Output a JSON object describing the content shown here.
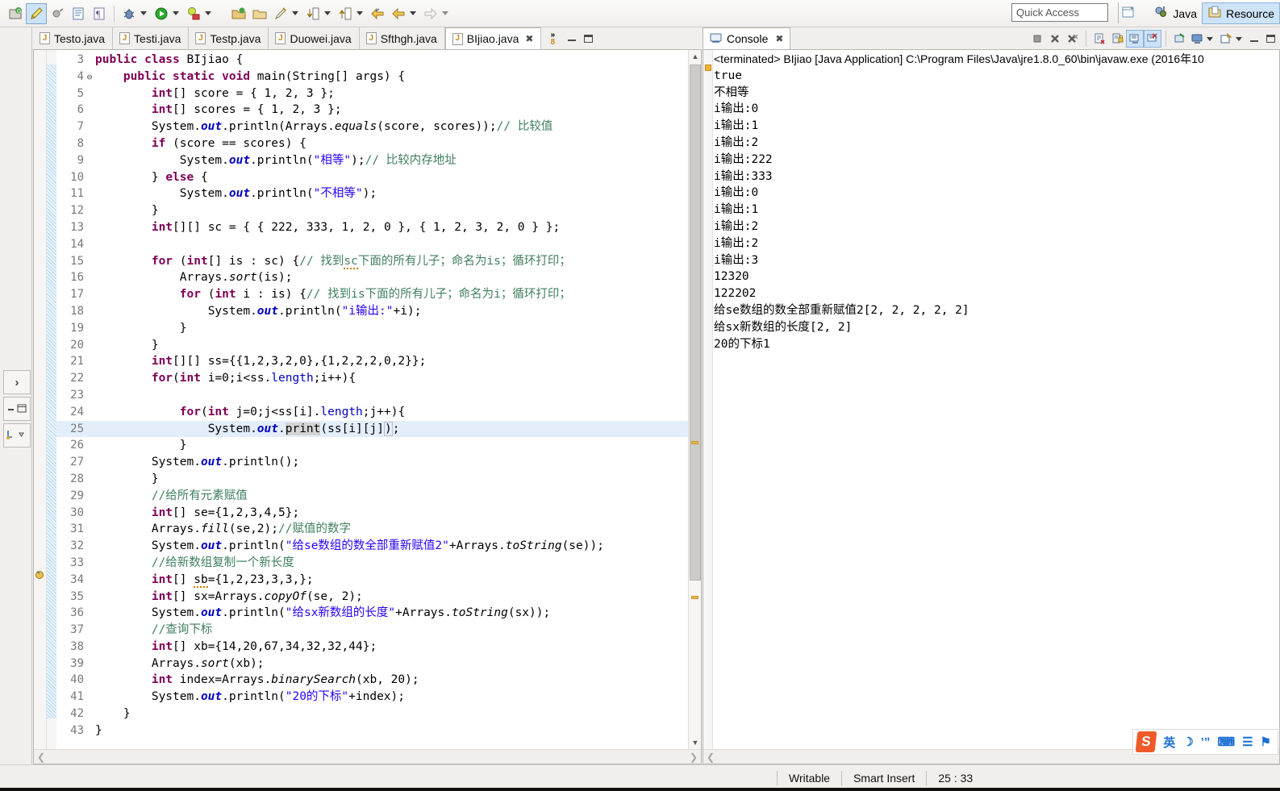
{
  "toolbar": {
    "icons": [
      {
        "name": "new-java-project-icon",
        "glyph": "⚙"
      },
      {
        "name": "highlighter-icon",
        "glyph": "✒"
      },
      {
        "name": "toggle-mark-occurrences-icon",
        "glyph": "●"
      },
      {
        "name": "open-type-icon",
        "glyph": "▤"
      },
      {
        "name": "show-whitespace-icon",
        "glyph": "¶"
      },
      {
        "name": "debug-icon",
        "glyph": "✹"
      },
      {
        "name": "run-icon",
        "glyph": "▶"
      },
      {
        "name": "run-external-tools-icon",
        "glyph": "●"
      },
      {
        "name": "new-java-package-icon",
        "glyph": "■"
      },
      {
        "name": "open-package-icon",
        "glyph": "□"
      },
      {
        "name": "new-class-icon",
        "glyph": "✎"
      },
      {
        "name": "previous-annotation-icon",
        "glyph": "↓"
      },
      {
        "name": "next-annotation-icon",
        "glyph": "↑"
      },
      {
        "name": "back-icon",
        "glyph": "⇐"
      },
      {
        "name": "backward-history-icon",
        "glyph": "⇐"
      },
      {
        "name": "forward-history-icon",
        "glyph": "⇒"
      }
    ],
    "quick_access_placeholder": "Quick Access",
    "perspective_open_label": "",
    "perspective_java_label": "Java",
    "perspective_resource_label": "Resource"
  },
  "editor": {
    "tabs": [
      {
        "label": "Testo.java",
        "active": false,
        "closable": false
      },
      {
        "label": "Testi.java",
        "active": false,
        "closable": false
      },
      {
        "label": "Testp.java",
        "active": false,
        "closable": false
      },
      {
        "label": "Duowei.java",
        "active": false,
        "closable": false
      },
      {
        "label": "Sfthgh.java",
        "active": false,
        "closable": false
      },
      {
        "label": "BIjiao.java",
        "active": true,
        "closable": true
      }
    ],
    "overflow_count": "8",
    "first_line_number": 3,
    "highlighted_line": 25,
    "lines": [
      {
        "n": "3",
        "fold": "",
        "html": "<span class=\"kw\">public class</span> <span class=\"plain\">BIjiao {</span>"
      },
      {
        "n": "4",
        "fold": "⊖",
        "html": "    <span class=\"kw\">public static void</span> <span class=\"plain\">main(String[] args) {</span>"
      },
      {
        "n": "5",
        "fold": "",
        "html": "        <span class=\"kw\">int</span><span class=\"plain\">[] score = { 1, 2, 3 };</span>"
      },
      {
        "n": "6",
        "fold": "",
        "html": "        <span class=\"kw\">int</span><span class=\"plain\">[] scores = { 1, 2, 3 };</span>"
      },
      {
        "n": "7",
        "fold": "",
        "html": "        <span class=\"plain\">System.</span><span class=\"stb\">out</span><span class=\"plain\">.println(Arrays.</span><span class=\"stat\">equals</span><span class=\"plain\">(score, scores));</span><span class=\"cmt\">// 比较值</span>"
      },
      {
        "n": "8",
        "fold": "",
        "html": "        <span class=\"kw\">if</span> <span class=\"plain\">(score == scores) {</span>"
      },
      {
        "n": "9",
        "fold": "",
        "html": "            <span class=\"plain\">System.</span><span class=\"stb\">out</span><span class=\"plain\">.println(</span><span class=\"str\">\"相等\"</span><span class=\"plain\">);</span><span class=\"cmt\">// 比较内存地址</span>"
      },
      {
        "n": "10",
        "fold": "",
        "html": "        <span class=\"plain\">} </span><span class=\"kw\">else</span> <span class=\"plain\">{</span>"
      },
      {
        "n": "11",
        "fold": "",
        "html": "            <span class=\"plain\">System.</span><span class=\"stb\">out</span><span class=\"plain\">.println(</span><span class=\"str\">\"不相等\"</span><span class=\"plain\">);</span>"
      },
      {
        "n": "12",
        "fold": "",
        "html": "        <span class=\"plain\">}</span>"
      },
      {
        "n": "13",
        "fold": "",
        "html": "        <span class=\"kw\">int</span><span class=\"plain\">[][] sc = { { 222, 333, 1, 2, 0 }, { 1, 2, 3, 2, 0 } };</span>"
      },
      {
        "n": "14",
        "fold": "",
        "html": ""
      },
      {
        "n": "15",
        "fold": "",
        "html": "        <span class=\"kw\">for</span> <span class=\"plain\">(</span><span class=\"kw\">int</span><span class=\"plain\">[] is : sc) {</span><span class=\"cmt\">// 找到</span><span class=\"cmt squiggle\">sc</span><span class=\"cmt\">下面的所有儿子；命名为is；循环打印；</span>"
      },
      {
        "n": "16",
        "fold": "",
        "html": "            <span class=\"plain\">Arrays.</span><span class=\"stat\">sort</span><span class=\"plain\">(is);</span>"
      },
      {
        "n": "17",
        "fold": "",
        "html": "            <span class=\"kw\">for</span> <span class=\"plain\">(</span><span class=\"kw\">int</span><span class=\"plain\"> i : is) {</span><span class=\"cmt\">// 找到is下面的所有儿子；命名为i；循环打印；</span>"
      },
      {
        "n": "18",
        "fold": "",
        "html": "                <span class=\"plain\">System.</span><span class=\"stb\">out</span><span class=\"plain\">.println(</span><span class=\"str\">\"i输出:\"</span><span class=\"plain\">+i);</span>"
      },
      {
        "n": "19",
        "fold": "",
        "html": "            <span class=\"plain\">}</span>"
      },
      {
        "n": "20",
        "fold": "",
        "html": "        <span class=\"plain\">}</span>"
      },
      {
        "n": "21",
        "fold": "",
        "html": "        <span class=\"kw\">int</span><span class=\"plain\">[][] ss={{1,2,3,2,0},{1,2,2,2,0,2}};</span>"
      },
      {
        "n": "22",
        "fold": "",
        "html": "        <span class=\"kw\">for</span><span class=\"plain\">(</span><span class=\"kw\">int</span><span class=\"plain\"> i=0;i&lt;ss.</span><span class=\"fld\">length</span><span class=\"plain\">;i++){</span>"
      },
      {
        "n": "23",
        "fold": "",
        "html": ""
      },
      {
        "n": "24",
        "fold": "",
        "html": "            <span class=\"kw\">for</span><span class=\"plain\">(</span><span class=\"kw\">int</span><span class=\"plain\"> j=0;j&lt;ss[i].</span><span class=\"fld\">length</span><span class=\"plain\">;j++){</span>"
      },
      {
        "n": "25",
        "fold": "",
        "html": "                <span class=\"plain\">System.</span><span class=\"stb\">out</span><span class=\"plain\">.</span><span class=\"sel-word\">print</span><span class=\"plain\">(ss[i][j]</span><span class=\"caret-box\">)</span><span class=\"plain\">;</span>"
      },
      {
        "n": "26",
        "fold": "",
        "html": "            <span class=\"plain\">}</span>"
      },
      {
        "n": "27",
        "fold": "",
        "html": "        <span class=\"plain\">System.</span><span class=\"stb\">out</span><span class=\"plain\">.println();</span>"
      },
      {
        "n": "28",
        "fold": "",
        "html": "        <span class=\"plain\">}</span>"
      },
      {
        "n": "29",
        "fold": "",
        "html": "        <span class=\"cmt\">//给所有元素赋值</span>"
      },
      {
        "n": "30",
        "fold": "",
        "html": "        <span class=\"kw\">int</span><span class=\"plain\">[] se={1,2,3,4,5};</span>"
      },
      {
        "n": "31",
        "fold": "",
        "html": "        <span class=\"plain\">Arrays.</span><span class=\"stat\">fill</span><span class=\"plain\">(se,2);</span><span class=\"cmt\">//赋值的数字</span>"
      },
      {
        "n": "32",
        "fold": "",
        "html": "        <span class=\"plain\">System.</span><span class=\"stb\">out</span><span class=\"plain\">.println(</span><span class=\"str\">\"给se数组的数全部重新赋值2\"</span><span class=\"plain\">+Arrays.</span><span class=\"stat\">toString</span><span class=\"plain\">(se));</span>"
      },
      {
        "n": "33",
        "fold": "",
        "html": "        <span class=\"cmt\">//给新数组复制一个新长度</span>"
      },
      {
        "n": "34",
        "fold": "",
        "html": "        <span class=\"kw\">int</span><span class=\"plain\">[] </span><span class=\"plain squiggle\">sb</span><span class=\"plain\">={1,2,23,3,3,};</span>"
      },
      {
        "n": "35",
        "fold": "",
        "html": "        <span class=\"kw\">int</span><span class=\"plain\">[] sx=Arrays.</span><span class=\"stat\">copyOf</span><span class=\"plain\">(se, 2);</span>"
      },
      {
        "n": "36",
        "fold": "",
        "html": "        <span class=\"plain\">System.</span><span class=\"stb\">out</span><span class=\"plain\">.println(</span><span class=\"str\">\"给sx新数组的长度\"</span><span class=\"plain\">+Arrays.</span><span class=\"stat\">toString</span><span class=\"plain\">(sx));</span>"
      },
      {
        "n": "37",
        "fold": "",
        "html": "        <span class=\"cmt\">//查询下标</span>"
      },
      {
        "n": "38",
        "fold": "",
        "html": "        <span class=\"kw\">int</span><span class=\"plain\">[] xb={14,20,67,34,32,32,44};</span>"
      },
      {
        "n": "39",
        "fold": "",
        "html": "        <span class=\"plain\">Arrays.</span><span class=\"stat\">sort</span><span class=\"plain\">(xb);</span>"
      },
      {
        "n": "40",
        "fold": "",
        "html": "        <span class=\"kw\">int</span><span class=\"plain\"> index=Arrays.</span><span class=\"stat\">binarySearch</span><span class=\"plain\">(xb, 20);</span>"
      },
      {
        "n": "41",
        "fold": "",
        "html": "        <span class=\"plain\">System.</span><span class=\"stb\">out</span><span class=\"plain\">.println(</span><span class=\"str\">\"20的下标\"</span><span class=\"plain\">+index);</span>"
      },
      {
        "n": "42",
        "fold": "",
        "html": "    <span class=\"plain\">}</span>"
      },
      {
        "n": "43",
        "fold": "",
        "html": "<span class=\"plain\">}</span>"
      }
    ]
  },
  "console": {
    "tab_label": "Console",
    "terminated_line": "<terminated> BIjiao [Java Application] C:\\Program Files\\Java\\jre1.8.0_60\\bin\\javaw.exe (2016年10",
    "output": [
      "true",
      "不相等",
      "i输出:0",
      "i输出:1",
      "i输出:2",
      "i输出:222",
      "i输出:333",
      "i输出:0",
      "i输出:1",
      "i输出:2",
      "i输出:2",
      "i输出:3",
      "12320",
      "122202",
      "给se数组的数全部重新赋值2[2, 2, 2, 2, 2]",
      "给sx新数组的长度[2, 2]",
      "20的下标1"
    ],
    "tools": [
      {
        "name": "terminate-icon",
        "glyph": "■",
        "selected": false
      },
      {
        "name": "remove-launch-icon",
        "glyph": "✕",
        "selected": false
      },
      {
        "name": "remove-all-terminated-icon",
        "glyph": "✕",
        "selected": false
      },
      {
        "name": "clear-console-icon",
        "glyph": "▤",
        "selected": false
      },
      {
        "name": "lock-scroll-icon",
        "glyph": "▤",
        "selected": false
      },
      {
        "name": "scroll-lock-icon",
        "glyph": "⌸",
        "selected": true
      },
      {
        "name": "show-console-on-error-icon",
        "glyph": "⌸",
        "selected": true
      },
      {
        "name": "pin-console-icon",
        "glyph": "▣",
        "selected": false
      },
      {
        "name": "display-selected-console-icon",
        "glyph": "▥",
        "selected": false
      },
      {
        "name": "open-console-icon",
        "glyph": "▧",
        "selected": false
      }
    ]
  },
  "ime": {
    "logo": "S",
    "items": [
      {
        "name": "ime-mode-english",
        "glyph": "英"
      },
      {
        "name": "ime-moon-icon",
        "glyph": "☽"
      },
      {
        "name": "ime-punctuation-icon",
        "glyph": "’”"
      },
      {
        "name": "ime-soft-keyboard-icon",
        "glyph": "⌨"
      },
      {
        "name": "ime-user-icon",
        "glyph": "☰"
      },
      {
        "name": "ime-toolbox-icon",
        "glyph": "⚑"
      }
    ]
  },
  "statusbar": {
    "writable": "Writable",
    "insert_mode": "Smart Insert",
    "cursor_position": "25 : 33"
  },
  "colors": {
    "accent_selection": "#cde3f7",
    "keyword": "#7f0055",
    "string": "#2a00ff",
    "comment": "#3f7f5f",
    "field": "#0000c0",
    "line_highlight": "#e4eefb",
    "chrome": "#f0efee"
  }
}
